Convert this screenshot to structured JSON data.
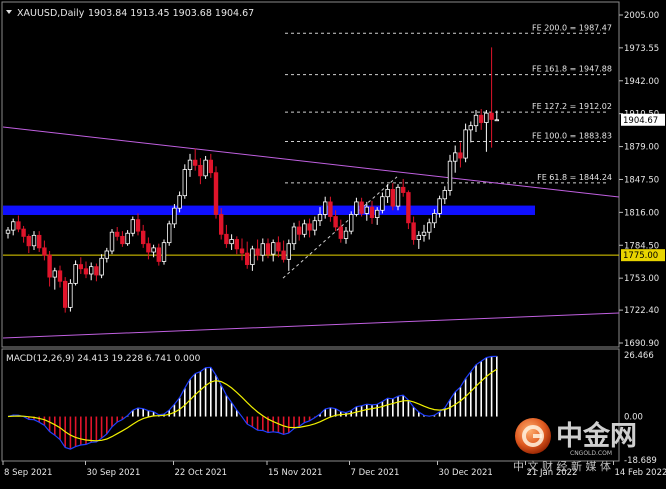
{
  "header": {
    "symbol": "XAUUSD,Daily",
    "ohlc": "1903.84 1913.45 1903.68 1904.67"
  },
  "price_axis": {
    "labels": [
      "2005.00",
      "1973.55",
      "1942.00",
      "1910.50",
      "1879.00",
      "1847.50",
      "1816.00",
      "1784.50",
      "1753.00",
      "1722.40",
      "1690.90"
    ],
    "current_price": "1904.67",
    "level_line": "1775.00"
  },
  "fib_levels": [
    {
      "label": "FE 200.0 = 1987.47"
    },
    {
      "label": "FE 161.8 = 1947.88"
    },
    {
      "label": "FE 127.2 = 1912.02"
    },
    {
      "label": "FE 100.0 = 1883.83"
    },
    {
      "label": "FE 61.8 = 1844.24"
    }
  ],
  "macd": {
    "title": "MACD(12,26,9) 24.413 19.228 6.741 0.000",
    "axis_labels": [
      "26.466",
      "0.00",
      "-18.689"
    ]
  },
  "time_axis": {
    "labels": [
      "8 Sep 2021",
      "30 Sep 2021",
      "22 Oct 2021",
      "15 Nov 2021",
      "7 Dec 2021",
      "30 Dec 2021",
      "21 Jan 2022",
      "14 Feb 2022"
    ]
  },
  "watermark": {
    "logo_text": "中金网",
    "url": "CNGOLD.COM",
    "slogan": "中 文 财 经 新 媒 体"
  },
  "colors": {
    "background": "#000000",
    "bull_candle": "#ffffff",
    "bear_candle": "#e0142b",
    "level_line": "#e8d400",
    "support_zone": "#1010ff",
    "trendline": "#c060e0",
    "macd_signal": "#f0f000",
    "macd_line": "#2040ff"
  },
  "chart_data": {
    "type": "candlestick",
    "symbol": "XAUUSD",
    "timeframe": "Daily",
    "ylim": [
      1690.9,
      2005.0
    ],
    "x_ticks": [
      "8 Sep 2021",
      "30 Sep 2021",
      "22 Oct 2021",
      "15 Nov 2021",
      "7 Dec 2021",
      "30 Dec 2021",
      "21 Jan 2022",
      "14 Feb 2022"
    ],
    "candles": [
      [
        1796,
        1802,
        1791,
        1799
      ],
      [
        1799,
        1810,
        1794,
        1807
      ],
      [
        1807,
        1813,
        1797,
        1800
      ],
      [
        1800,
        1803,
        1787,
        1793
      ],
      [
        1793,
        1795,
        1777,
        1784
      ],
      [
        1784,
        1798,
        1780,
        1794
      ],
      [
        1794,
        1798,
        1778,
        1782
      ],
      [
        1782,
        1789,
        1770,
        1775
      ],
      [
        1775,
        1779,
        1745,
        1754
      ],
      [
        1754,
        1763,
        1742,
        1760
      ],
      [
        1760,
        1765,
        1744,
        1750
      ],
      [
        1750,
        1754,
        1720,
        1725
      ],
      [
        1725,
        1752,
        1721,
        1748
      ],
      [
        1748,
        1770,
        1746,
        1766
      ],
      [
        1766,
        1773,
        1757,
        1762
      ],
      [
        1762,
        1769,
        1753,
        1757
      ],
      [
        1757,
        1768,
        1751,
        1764
      ],
      [
        1764,
        1767,
        1750,
        1756
      ],
      [
        1756,
        1776,
        1753,
        1772
      ],
      [
        1772,
        1782,
        1768,
        1779
      ],
      [
        1779,
        1800,
        1776,
        1797
      ],
      [
        1797,
        1802,
        1789,
        1793
      ],
      [
        1793,
        1798,
        1783,
        1786
      ],
      [
        1786,
        1799,
        1784,
        1796
      ],
      [
        1796,
        1812,
        1793,
        1809
      ],
      [
        1809,
        1815,
        1794,
        1798
      ],
      [
        1798,
        1804,
        1782,
        1786
      ],
      [
        1786,
        1792,
        1771,
        1778
      ],
      [
        1778,
        1785,
        1773,
        1782
      ],
      [
        1782,
        1786,
        1765,
        1769
      ],
      [
        1769,
        1790,
        1766,
        1787
      ],
      [
        1787,
        1808,
        1784,
        1805
      ],
      [
        1805,
        1824,
        1801,
        1820
      ],
      [
        1820,
        1836,
        1816,
        1832
      ],
      [
        1832,
        1862,
        1829,
        1857
      ],
      [
        1857,
        1872,
        1850,
        1866
      ],
      [
        1866,
        1877,
        1856,
        1861
      ],
      [
        1861,
        1868,
        1843,
        1851
      ],
      [
        1851,
        1870,
        1848,
        1866
      ],
      [
        1866,
        1872,
        1849,
        1854
      ],
      [
        1854,
        1860,
        1810,
        1814
      ],
      [
        1814,
        1820,
        1790,
        1795
      ],
      [
        1795,
        1804,
        1782,
        1786
      ],
      [
        1786,
        1795,
        1780,
        1790
      ],
      [
        1790,
        1793,
        1776,
        1781
      ],
      [
        1781,
        1791,
        1770,
        1777
      ],
      [
        1777,
        1788,
        1762,
        1766
      ],
      [
        1766,
        1784,
        1760,
        1781
      ],
      [
        1781,
        1790,
        1770,
        1775
      ],
      [
        1775,
        1791,
        1769,
        1786
      ],
      [
        1786,
        1791,
        1772,
        1776
      ],
      [
        1776,
        1790,
        1769,
        1787
      ],
      [
        1787,
        1793,
        1773,
        1779
      ],
      [
        1779,
        1789,
        1768,
        1771
      ],
      [
        1771,
        1790,
        1760,
        1786
      ],
      [
        1786,
        1806,
        1780,
        1802
      ],
      [
        1802,
        1808,
        1789,
        1795
      ],
      [
        1795,
        1809,
        1792,
        1805
      ],
      [
        1805,
        1810,
        1792,
        1799
      ],
      [
        1799,
        1812,
        1794,
        1808
      ],
      [
        1808,
        1821,
        1803,
        1814
      ],
      [
        1814,
        1831,
        1810,
        1826
      ],
      [
        1826,
        1831,
        1807,
        1812
      ],
      [
        1812,
        1818,
        1798,
        1802
      ],
      [
        1802,
        1809,
        1787,
        1791
      ],
      [
        1791,
        1802,
        1786,
        1798
      ],
      [
        1798,
        1817,
        1795,
        1814
      ],
      [
        1814,
        1830,
        1812,
        1826
      ],
      [
        1826,
        1830,
        1812,
        1815
      ],
      [
        1815,
        1826,
        1808,
        1821
      ],
      [
        1821,
        1827,
        1805,
        1811
      ],
      [
        1811,
        1821,
        1804,
        1818
      ],
      [
        1818,
        1835,
        1815,
        1831
      ],
      [
        1831,
        1843,
        1825,
        1838
      ],
      [
        1838,
        1844,
        1818,
        1822
      ],
      [
        1822,
        1843,
        1818,
        1840
      ],
      [
        1840,
        1848,
        1831,
        1835
      ],
      [
        1835,
        1837,
        1800,
        1806
      ],
      [
        1806,
        1812,
        1785,
        1790
      ],
      [
        1790,
        1798,
        1781,
        1794
      ],
      [
        1794,
        1804,
        1788,
        1797
      ],
      [
        1797,
        1810,
        1790,
        1806
      ],
      [
        1806,
        1819,
        1801,
        1815
      ],
      [
        1815,
        1832,
        1811,
        1829
      ],
      [
        1829,
        1841,
        1824,
        1837
      ],
      [
        1837,
        1871,
        1832,
        1865
      ],
      [
        1865,
        1880,
        1854,
        1873
      ],
      [
        1873,
        1883,
        1859,
        1868
      ],
      [
        1868,
        1901,
        1864,
        1895
      ],
      [
        1895,
        1903,
        1883,
        1899
      ],
      [
        1899,
        1914,
        1893,
        1909
      ],
      [
        1909,
        1915,
        1895,
        1902
      ],
      [
        1902,
        1914,
        1874,
        1911
      ],
      [
        1911,
        1974,
        1878,
        1905
      ],
      [
        1903.84,
        1913.45,
        1903.68,
        1904.67
      ]
    ]
  }
}
